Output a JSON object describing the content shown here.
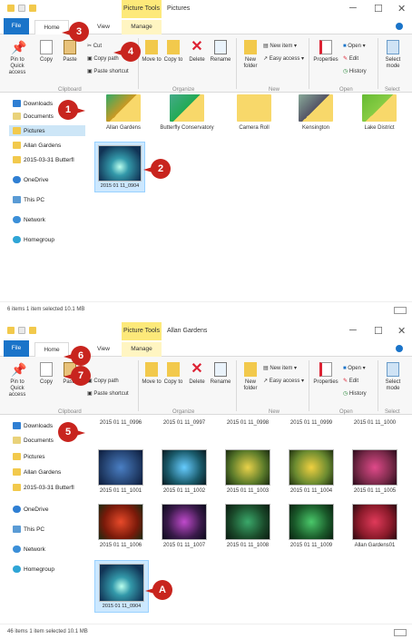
{
  "window1": {
    "context_tab": "Picture Tools",
    "title": "Pictures",
    "tabs": {
      "file": "File",
      "home": "Home",
      "view": "View",
      "manage": "Manage"
    },
    "ribbon": {
      "pin": "Pin to Quick access",
      "copy": "Copy",
      "paste": "Paste",
      "cut": "Cut",
      "copy_path": "Copy path",
      "paste_shortcut": "Paste shortcut",
      "move_to": "Move to",
      "copy_to": "Copy to",
      "delete": "Delete",
      "rename": "Rename",
      "new_folder": "New folder",
      "new_item": "New item",
      "easy_access": "Easy access",
      "properties": "Properties",
      "open": "Open",
      "edit": "Edit",
      "history": "History",
      "select_mode": "Select mode",
      "groups": {
        "clipboard": "Clipboard",
        "organize": "Organize",
        "new": "New",
        "open": "Open",
        "select": "Select"
      }
    },
    "nav": [
      "Downloads",
      "Documents",
      "Pictures",
      "Allan Gardens",
      "2015-03-31 Butterfl",
      "OneDrive",
      "This PC",
      "Network",
      "Homegroup"
    ],
    "folders": [
      "Allan Gardens",
      "Butterfly Conservatory",
      "Camera Roll",
      "Kensington",
      "Lake District"
    ],
    "selected_file": "2015 01 11_0904",
    "status": "6 items    1 item selected  10.1 MB",
    "badges": [
      "1",
      "2",
      "3",
      "4"
    ]
  },
  "window2": {
    "context_tab": "Picture Tools",
    "title": "Allan Gardens",
    "row0": [
      "2015 01 11_0996",
      "2015 01 11_0997",
      "2015 01 11_0998",
      "2015 01 11_0999",
      "2015 01 11_1000"
    ],
    "row1": [
      "2015 01 11_1001",
      "2015 01 11_1002",
      "2015 01 11_1003",
      "2015 01 11_1004",
      "2015 01 11_1005"
    ],
    "row2": [
      "2015 01 11_1006",
      "2015 01 11_1007",
      "2015 01 11_1008",
      "2015 01 11_1009",
      "Allan Gardens01"
    ],
    "pasted_file": "2015 01 11_0904",
    "status": "46 items    1 item selected  10.1 MB",
    "badges": [
      "5",
      "6",
      "7",
      "A"
    ]
  },
  "colors": {
    "accent": "#1a74c9",
    "context": "#fde97a",
    "badge": "#c8241e",
    "folder": "#f8d86a"
  }
}
